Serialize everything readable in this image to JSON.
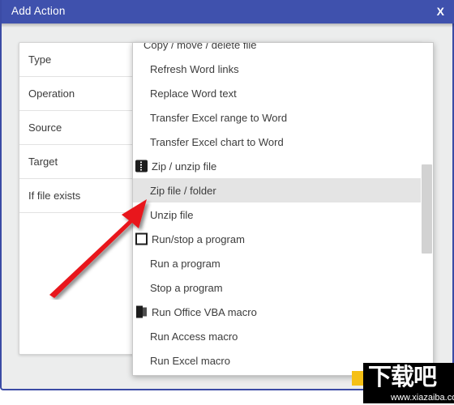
{
  "window": {
    "title": "Add Action",
    "close_label": "X",
    "accent_color": "#3f51ad",
    "body_color": "#eceded"
  },
  "form": {
    "rows": [
      {
        "label": "Type",
        "has_browse": false
      },
      {
        "label": "Operation",
        "has_browse": false
      },
      {
        "label": "Source",
        "has_browse": true
      },
      {
        "label": "Target",
        "has_browse": true
      },
      {
        "label": "If file exists",
        "has_browse": false
      }
    ]
  },
  "dropdown": {
    "scroll_up_icon": "arrow-up-icon",
    "items": [
      {
        "label": "Copy / move / delete file",
        "type": "group",
        "icon": null,
        "highlight": false
      },
      {
        "label": "Refresh Word links",
        "type": "option",
        "icon": null,
        "highlight": false
      },
      {
        "label": "Replace Word text",
        "type": "option",
        "icon": null,
        "highlight": false
      },
      {
        "label": "Transfer Excel range to Word",
        "type": "option",
        "icon": null,
        "highlight": false
      },
      {
        "label": "Transfer Excel chart to Word",
        "type": "option",
        "icon": null,
        "highlight": false
      },
      {
        "label": "Zip / unzip file",
        "type": "group",
        "icon": "zip-icon",
        "highlight": false
      },
      {
        "label": "Zip file / folder",
        "type": "option",
        "icon": null,
        "highlight": true
      },
      {
        "label": "Unzip file",
        "type": "option",
        "icon": null,
        "highlight": false
      },
      {
        "label": "Run/stop a program",
        "type": "group",
        "icon": "window-icon",
        "highlight": false
      },
      {
        "label": "Run a program",
        "type": "option",
        "icon": null,
        "highlight": false
      },
      {
        "label": "Stop a program",
        "type": "option",
        "icon": null,
        "highlight": false
      },
      {
        "label": "Run Office VBA macro",
        "type": "group",
        "icon": "office-icon",
        "highlight": false
      },
      {
        "label": "Run Access macro",
        "type": "option",
        "icon": null,
        "highlight": false
      },
      {
        "label": "Run Excel macro",
        "type": "option",
        "icon": null,
        "highlight": false
      }
    ]
  },
  "annotation": {
    "arrow_color": "#e8191a",
    "points_to": "Zip file / folder"
  },
  "watermark": {
    "brand": "下载吧",
    "url": "www.xiazaiba.com"
  }
}
